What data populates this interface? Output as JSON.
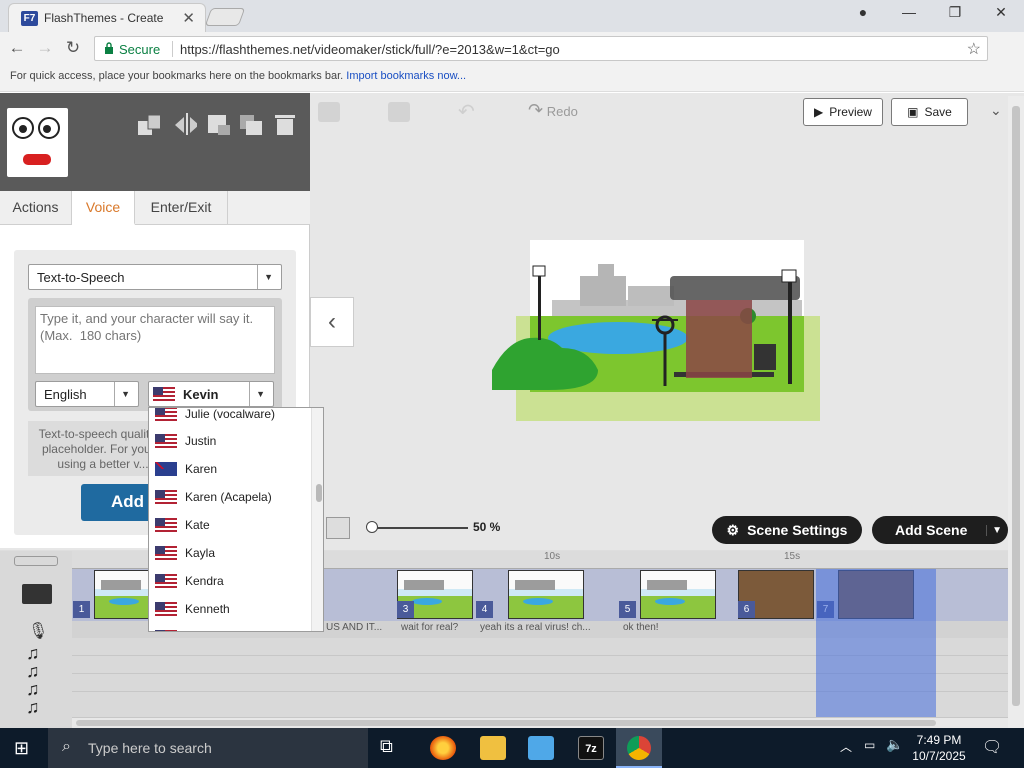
{
  "browser": {
    "tab_title": "FlashThemes - Create",
    "favicon_text": "F7",
    "secure_label": "Secure",
    "url": "https://flashthemes.net/videomaker/stick/full/?e=2013&w=1&ct=go",
    "bookmark_hint": "For quick access, place your bookmarks here on the bookmarks bar.",
    "bookmark_link": "Import bookmarks now..."
  },
  "toolbar": {
    "redo_label": "Redo",
    "preview_label": "Preview",
    "save_label": "Save"
  },
  "panel": {
    "tabs": [
      "Actions",
      "Voice",
      "Enter/Exit"
    ],
    "active_tab": "Voice",
    "voice_mode": "Text-to-Speech",
    "tts_placeholder": "Type it, and your character will say it.  (Max.  180 chars)",
    "language": "English",
    "voice": "Kevin",
    "note": "Text-to-speech quality is placeholder. For your... using a better v...",
    "add_label": "Add"
  },
  "voice_options": [
    {
      "name": "Julie (vocalware)",
      "flag": "us"
    },
    {
      "name": "Justin",
      "flag": "us"
    },
    {
      "name": "Karen",
      "flag": "au"
    },
    {
      "name": "Karen (Acapela)",
      "flag": "us"
    },
    {
      "name": "Kate",
      "flag": "us"
    },
    {
      "name": "Kayla",
      "flag": "us"
    },
    {
      "name": "Kendra",
      "flag": "us"
    },
    {
      "name": "Kenneth",
      "flag": "us"
    }
  ],
  "controls": {
    "zoom_label": "50 %",
    "zoom_level_pct": 50,
    "scene_settings_label": "Scene Settings",
    "add_scene_label": "Add Scene"
  },
  "timeline": {
    "ticks": [
      "10s",
      "15s"
    ],
    "scenes": [
      "1",
      "3",
      "4",
      "5",
      "6",
      "7"
    ],
    "voice_lines": [
      "US AND IT...",
      "wait for real?",
      "yeah its a real virus! ch...",
      "ok then!"
    ]
  },
  "taskbar": {
    "search_placeholder": "Type here to search",
    "time": "7:49 PM",
    "date": "10/7/2025"
  },
  "colors": {
    "accent_orange": "#d9782a",
    "timeline_blue": "#4a5a9a",
    "secure_green": "#0b8043"
  }
}
